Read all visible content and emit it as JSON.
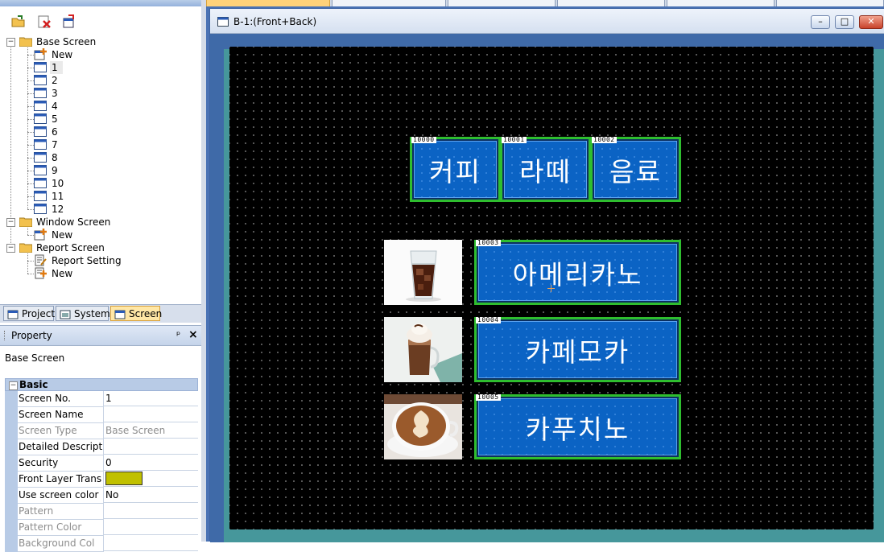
{
  "project_toolbar": {
    "icons": [
      "open-folder-icon",
      "delete-icon",
      "properties-icon"
    ]
  },
  "tree": {
    "base_screen": "Base Screen",
    "base_new": "New",
    "screens": [
      "1",
      "2",
      "3",
      "4",
      "5",
      "6",
      "7",
      "8",
      "9",
      "10",
      "11",
      "12"
    ],
    "window_screen": "Window Screen",
    "window_new": "New",
    "report_screen": "Report Screen",
    "report_setting": "Report Setting",
    "report_new": "New",
    "expand_glyph": "⊟"
  },
  "panel_tabs": [
    "Project",
    "System",
    "Screen"
  ],
  "property": {
    "title": "Property",
    "pin": "ᵖ",
    "close": "×",
    "selected_object": "Base Screen",
    "category": "Basic",
    "rows": [
      {
        "key": "Screen No.",
        "value": "1"
      },
      {
        "key": "Screen Name",
        "value": ""
      },
      {
        "key": "Screen Type",
        "value": "Base Screen"
      },
      {
        "key": "Detailed Descriptic",
        "value": ""
      },
      {
        "key": "Security",
        "value": "0"
      },
      {
        "key": "Front Layer Trans",
        "value": ""
      },
      {
        "key": "Use screen color",
        "value": "No"
      },
      {
        "key": "Pattern",
        "value": ""
      },
      {
        "key": "Pattern Color",
        "value": ""
      },
      {
        "key": "Background Col",
        "value": ""
      }
    ],
    "front_layer_color": "#c0c000"
  },
  "editor": {
    "window_title": "B-1:(Front+Back)",
    "min": "–",
    "max": "□",
    "close": "✕"
  },
  "hmi": {
    "top_buttons": [
      {
        "id": "10000",
        "label": "커피"
      },
      {
        "id": "10001",
        "label": "라떼"
      },
      {
        "id": "10002",
        "label": "음료"
      }
    ],
    "menu_buttons": [
      {
        "id": "10003",
        "label": "아메리카노"
      },
      {
        "id": "10004",
        "label": "카페모카"
      },
      {
        "id": "10005",
        "label": "카푸치노"
      }
    ],
    "colors": {
      "button": "#0b63c4",
      "border": "#2fbe2f",
      "canvas": "#000000"
    }
  }
}
